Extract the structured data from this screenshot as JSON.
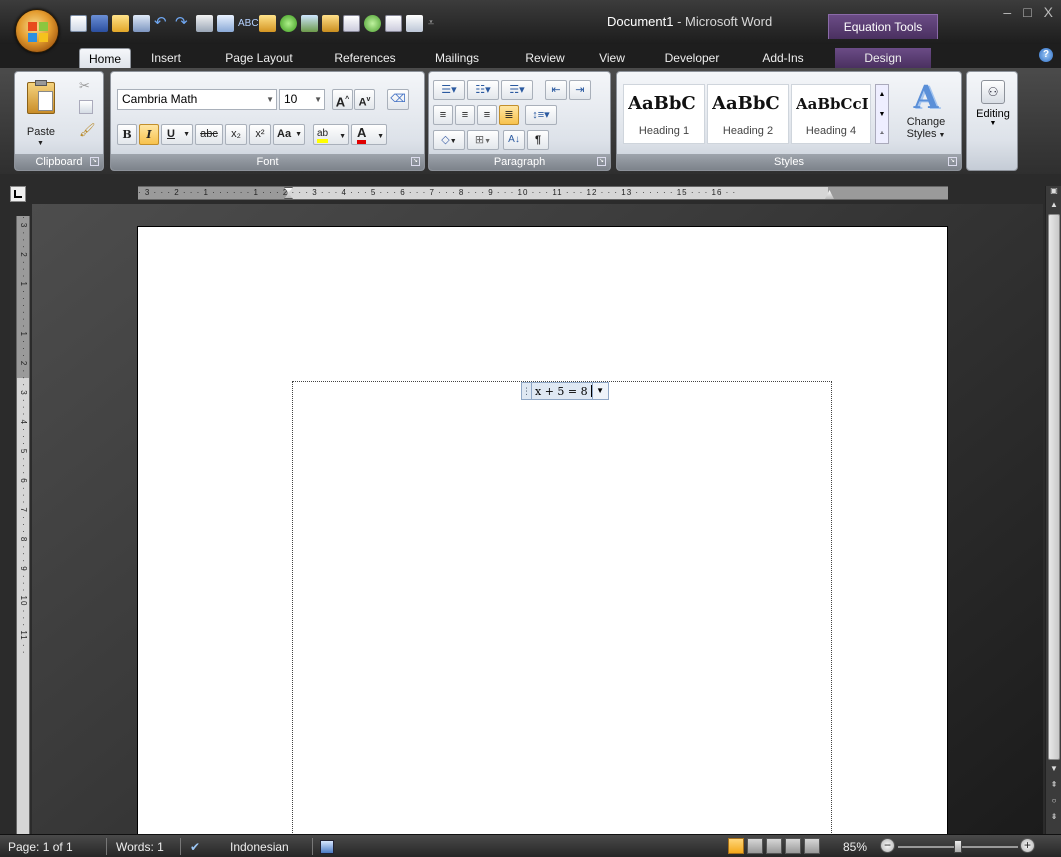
{
  "window": {
    "document_name": "Document1",
    "title_separator": " - ",
    "app_name": "Microsoft Word",
    "contextual_tab": "Equation Tools",
    "controls": [
      "–",
      "□",
      "X"
    ]
  },
  "tabs": [
    "Home",
    "Insert",
    "Page Layout",
    "References",
    "Mailings",
    "Review",
    "View",
    "Developer",
    "Add-Ins",
    "Design"
  ],
  "active_tab": "Home",
  "help_label": "?",
  "ribbon": {
    "clipboard": {
      "label": "Clipboard",
      "paste": "Paste"
    },
    "font": {
      "label": "Font",
      "font_name": "Cambria Math",
      "font_size": "10",
      "grow": "A",
      "shrink": "A",
      "bold": "B",
      "italic": "I",
      "underline": "U",
      "strike": "abc",
      "subscript": "x₂",
      "superscript": "x²",
      "change_case": "Aa",
      "highlight": "ab",
      "font_color": "A"
    },
    "paragraph": {
      "label": "Paragraph",
      "sort": "A↓",
      "pilcrow": "¶"
    },
    "styles": {
      "label": "Styles",
      "items": [
        {
          "sample": "AaBbC",
          "name": "Heading 1"
        },
        {
          "sample": "AaBbC",
          "name": "Heading 2"
        },
        {
          "sample": "AaBbCcI",
          "name": "Heading 4"
        }
      ],
      "change_styles": "Change Styles",
      "change_styles_line1": "Change",
      "change_styles_line2": "Styles"
    },
    "editing": {
      "label": "Editing"
    }
  },
  "ruler": {
    "horizontal": "· 3 · · · 2 · · · 1 · · · · · · 1 · · · 2 · · · 3 · · · 4 · · · 5 · · · 6 · · · 7 · · · 8 · · · 9 · · · 10 · · · 11 · · · 12 · · · 13 · · · · · · 15 · · · 16 · ·",
    "vertical": "· 3 · · · 2 · · · 1 · · · · · · 1 · · · 2 · · · 3 · · · 4 · · · 5 · · · 6 · · · 7 · · · 8 · · · 9 · · · 10 · · · 11 · ·"
  },
  "document": {
    "equation": "x + 5 = 8"
  },
  "status": {
    "page": "Page: 1 of 1",
    "words": "Words: 1",
    "language": "Indonesian",
    "zoom": "85%",
    "zoom_level": 0.85
  },
  "colors": {
    "dark_frame": "#2b2b2b",
    "ribbon_group": "#dde2e9",
    "contextual_tab": "#5b3f74",
    "highlight_yellow": "#ffd67a",
    "font_color_red": "#e00000"
  }
}
